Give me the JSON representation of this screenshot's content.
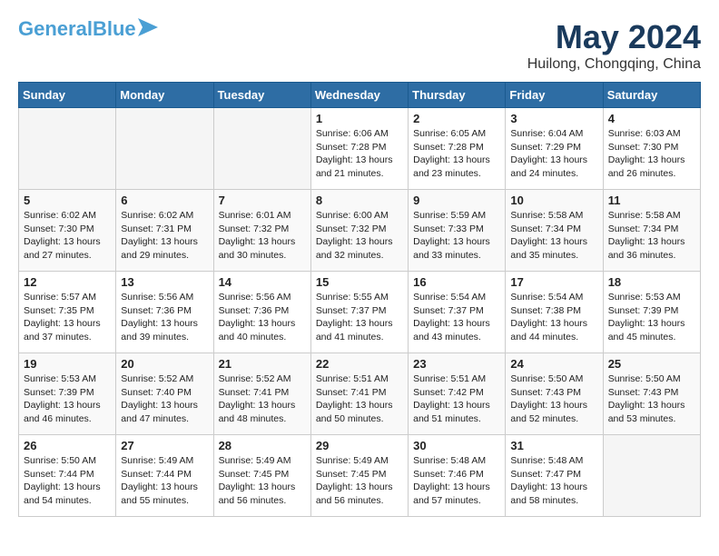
{
  "app": {
    "logo_line1": "General",
    "logo_line2": "Blue"
  },
  "title": "May 2024",
  "location": "Huilong, Chongqing, China",
  "days_of_week": [
    "Sunday",
    "Monday",
    "Tuesday",
    "Wednesday",
    "Thursday",
    "Friday",
    "Saturday"
  ],
  "weeks": [
    [
      {
        "day": "",
        "info": ""
      },
      {
        "day": "",
        "info": ""
      },
      {
        "day": "",
        "info": ""
      },
      {
        "day": "1",
        "info": "Sunrise: 6:06 AM\nSunset: 7:28 PM\nDaylight: 13 hours and 21 minutes."
      },
      {
        "day": "2",
        "info": "Sunrise: 6:05 AM\nSunset: 7:28 PM\nDaylight: 13 hours and 23 minutes."
      },
      {
        "day": "3",
        "info": "Sunrise: 6:04 AM\nSunset: 7:29 PM\nDaylight: 13 hours and 24 minutes."
      },
      {
        "day": "4",
        "info": "Sunrise: 6:03 AM\nSunset: 7:30 PM\nDaylight: 13 hours and 26 minutes."
      }
    ],
    [
      {
        "day": "5",
        "info": "Sunrise: 6:02 AM\nSunset: 7:30 PM\nDaylight: 13 hours and 27 minutes."
      },
      {
        "day": "6",
        "info": "Sunrise: 6:02 AM\nSunset: 7:31 PM\nDaylight: 13 hours and 29 minutes."
      },
      {
        "day": "7",
        "info": "Sunrise: 6:01 AM\nSunset: 7:32 PM\nDaylight: 13 hours and 30 minutes."
      },
      {
        "day": "8",
        "info": "Sunrise: 6:00 AM\nSunset: 7:32 PM\nDaylight: 13 hours and 32 minutes."
      },
      {
        "day": "9",
        "info": "Sunrise: 5:59 AM\nSunset: 7:33 PM\nDaylight: 13 hours and 33 minutes."
      },
      {
        "day": "10",
        "info": "Sunrise: 5:58 AM\nSunset: 7:34 PM\nDaylight: 13 hours and 35 minutes."
      },
      {
        "day": "11",
        "info": "Sunrise: 5:58 AM\nSunset: 7:34 PM\nDaylight: 13 hours and 36 minutes."
      }
    ],
    [
      {
        "day": "12",
        "info": "Sunrise: 5:57 AM\nSunset: 7:35 PM\nDaylight: 13 hours and 37 minutes."
      },
      {
        "day": "13",
        "info": "Sunrise: 5:56 AM\nSunset: 7:36 PM\nDaylight: 13 hours and 39 minutes."
      },
      {
        "day": "14",
        "info": "Sunrise: 5:56 AM\nSunset: 7:36 PM\nDaylight: 13 hours and 40 minutes."
      },
      {
        "day": "15",
        "info": "Sunrise: 5:55 AM\nSunset: 7:37 PM\nDaylight: 13 hours and 41 minutes."
      },
      {
        "day": "16",
        "info": "Sunrise: 5:54 AM\nSunset: 7:37 PM\nDaylight: 13 hours and 43 minutes."
      },
      {
        "day": "17",
        "info": "Sunrise: 5:54 AM\nSunset: 7:38 PM\nDaylight: 13 hours and 44 minutes."
      },
      {
        "day": "18",
        "info": "Sunrise: 5:53 AM\nSunset: 7:39 PM\nDaylight: 13 hours and 45 minutes."
      }
    ],
    [
      {
        "day": "19",
        "info": "Sunrise: 5:53 AM\nSunset: 7:39 PM\nDaylight: 13 hours and 46 minutes."
      },
      {
        "day": "20",
        "info": "Sunrise: 5:52 AM\nSunset: 7:40 PM\nDaylight: 13 hours and 47 minutes."
      },
      {
        "day": "21",
        "info": "Sunrise: 5:52 AM\nSunset: 7:41 PM\nDaylight: 13 hours and 48 minutes."
      },
      {
        "day": "22",
        "info": "Sunrise: 5:51 AM\nSunset: 7:41 PM\nDaylight: 13 hours and 50 minutes."
      },
      {
        "day": "23",
        "info": "Sunrise: 5:51 AM\nSunset: 7:42 PM\nDaylight: 13 hours and 51 minutes."
      },
      {
        "day": "24",
        "info": "Sunrise: 5:50 AM\nSunset: 7:43 PM\nDaylight: 13 hours and 52 minutes."
      },
      {
        "day": "25",
        "info": "Sunrise: 5:50 AM\nSunset: 7:43 PM\nDaylight: 13 hours and 53 minutes."
      }
    ],
    [
      {
        "day": "26",
        "info": "Sunrise: 5:50 AM\nSunset: 7:44 PM\nDaylight: 13 hours and 54 minutes."
      },
      {
        "day": "27",
        "info": "Sunrise: 5:49 AM\nSunset: 7:44 PM\nDaylight: 13 hours and 55 minutes."
      },
      {
        "day": "28",
        "info": "Sunrise: 5:49 AM\nSunset: 7:45 PM\nDaylight: 13 hours and 56 minutes."
      },
      {
        "day": "29",
        "info": "Sunrise: 5:49 AM\nSunset: 7:45 PM\nDaylight: 13 hours and 56 minutes."
      },
      {
        "day": "30",
        "info": "Sunrise: 5:48 AM\nSunset: 7:46 PM\nDaylight: 13 hours and 57 minutes."
      },
      {
        "day": "31",
        "info": "Sunrise: 5:48 AM\nSunset: 7:47 PM\nDaylight: 13 hours and 58 minutes."
      },
      {
        "day": "",
        "info": ""
      }
    ]
  ]
}
